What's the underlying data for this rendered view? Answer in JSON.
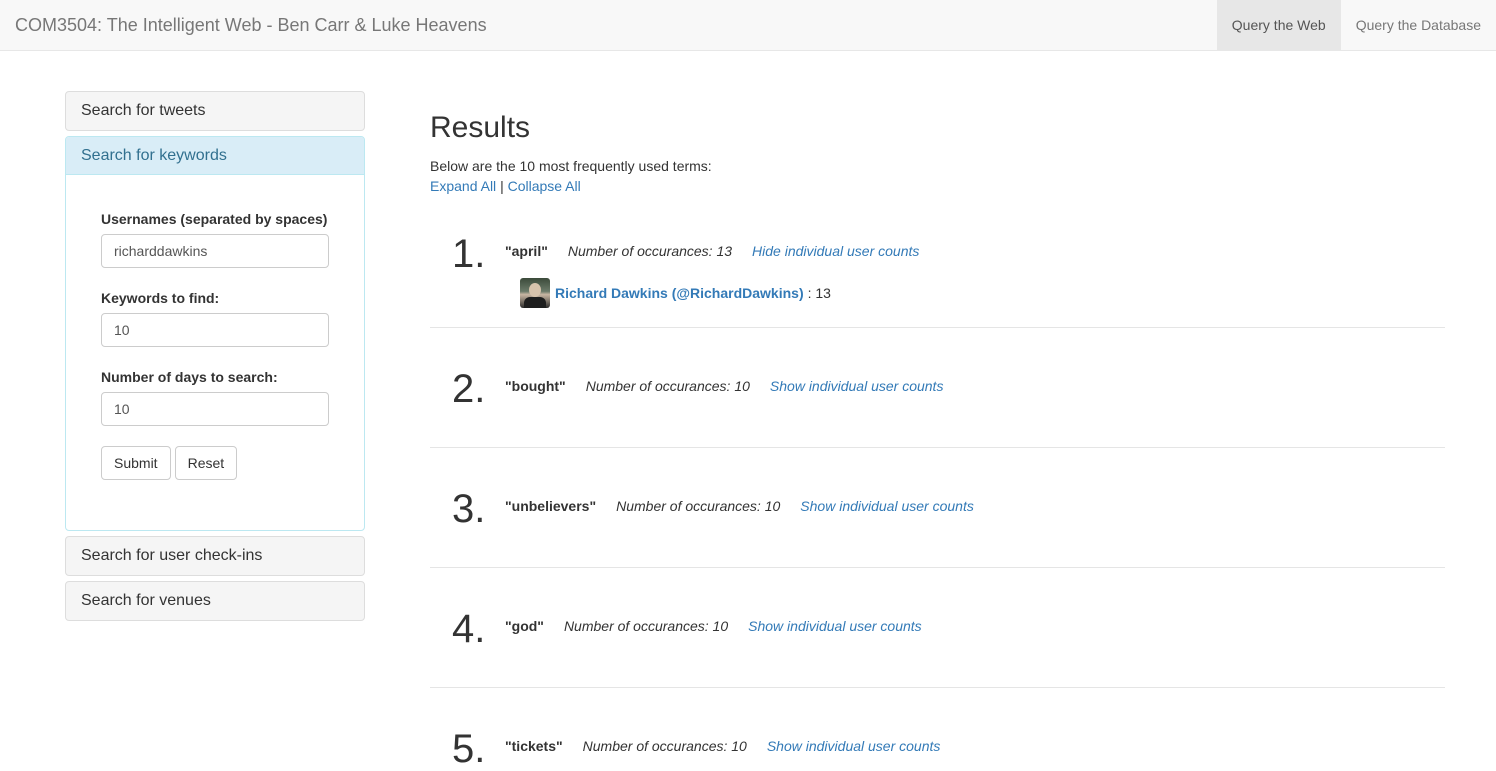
{
  "navbar": {
    "brand": "COM3504: The Intelligent Web - Ben Carr & Luke Heavens",
    "items": [
      {
        "label": "Query the Web",
        "active": true
      },
      {
        "label": "Query the Database",
        "active": false
      }
    ]
  },
  "sidebar": {
    "panels": [
      {
        "title": "Search for tweets"
      },
      {
        "title": "Search for keywords"
      },
      {
        "title": "Search for user check-ins"
      },
      {
        "title": "Search for venues"
      }
    ],
    "form": {
      "usernames_label": "Usernames (separated by spaces)",
      "usernames_value": "richarddawkins",
      "keywords_label": "Keywords to find:",
      "keywords_value": "10",
      "days_label": "Number of days to search:",
      "days_value": "10",
      "submit_label": "Submit",
      "reset_label": "Reset"
    }
  },
  "main": {
    "title": "Results",
    "intro": "Below are the 10 most frequently used terms:",
    "expand_all": "Expand All",
    "separator": "|",
    "collapse_all": "Collapse All"
  },
  "results": [
    {
      "rank": "1.",
      "term": "\"april\"",
      "occurrences": "Number of occurances: 13",
      "toggle": "Hide individual user counts",
      "user": {
        "name": "Richard Dawkins (@RichardDawkins)",
        "count": ": 13"
      }
    },
    {
      "rank": "2.",
      "term": "\"bought\"",
      "occurrences": "Number of occurances: 10",
      "toggle": "Show individual user counts"
    },
    {
      "rank": "3.",
      "term": "\"unbelievers\"",
      "occurrences": "Number of occurances: 10",
      "toggle": "Show individual user counts"
    },
    {
      "rank": "4.",
      "term": "\"god\"",
      "occurrences": "Number of occurances: 10",
      "toggle": "Show individual user counts"
    },
    {
      "rank": "5.",
      "term": "\"tickets\"",
      "occurrences": "Number of occurances: 10",
      "toggle": "Show individual user counts"
    }
  ]
}
